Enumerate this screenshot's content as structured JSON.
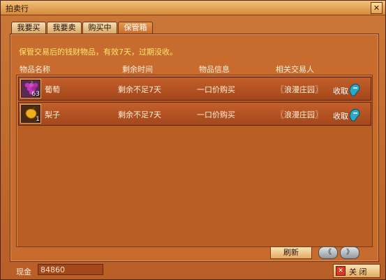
{
  "window": {
    "title": "拍卖行",
    "close_glyph": "✕"
  },
  "tabs": [
    {
      "label": "我要买",
      "active": false
    },
    {
      "label": "我要卖",
      "active": false
    },
    {
      "label": "购买中",
      "active": false
    },
    {
      "label": "保管箱",
      "active": true
    }
  ],
  "notice": "保管交易后的钱财物品，有效7天，过期没收。",
  "columns": {
    "name": "物品名称",
    "remaining": "剩余时间",
    "info": "物品信息",
    "trader": "相关交易人"
  },
  "items": [
    {
      "icon": "grape-icon",
      "quantity": "63",
      "name": "葡萄",
      "remaining": "剩余不足7天",
      "info": "一口价购买",
      "trader": "〖浪漫庄园〗",
      "action": "收取"
    },
    {
      "icon": "pear-icon",
      "quantity": "1",
      "name": "梨子",
      "remaining": "剩余不足7天",
      "info": "一口价购买",
      "trader": "〖浪漫庄园〗",
      "action": "收取"
    }
  ],
  "buttons": {
    "refresh": "刷新",
    "prev_glyph": "《",
    "next_glyph": "》",
    "close": "关 闭",
    "close_icon_glyph": "✕"
  },
  "cash": {
    "label": "现金",
    "value": "84860"
  },
  "colors": {
    "notice": "#ffe86b",
    "panel": "#c86b2f",
    "row": "#b34f20"
  }
}
